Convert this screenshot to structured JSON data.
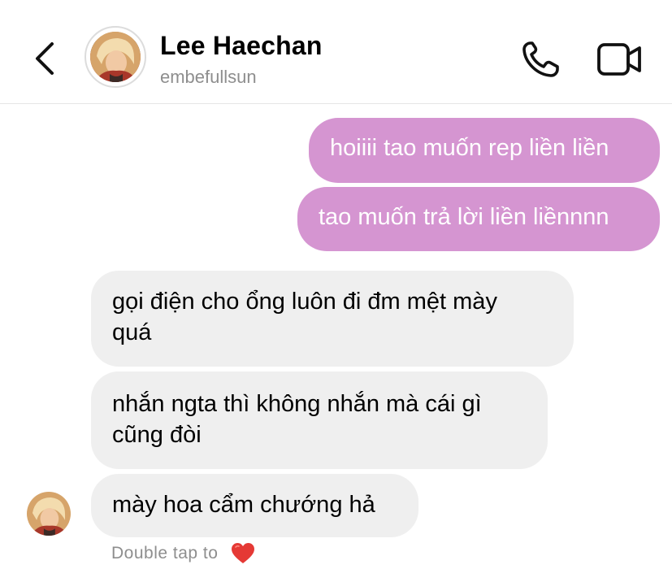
{
  "header": {
    "name": "Lee Haechan",
    "username": "embefullsun"
  },
  "messages": [
    {
      "direction": "sent",
      "text": "hoiiii tao muốn rep liền liền"
    },
    {
      "direction": "sent",
      "text": "tao muốn trả lời liền liềnnnn"
    },
    {
      "direction": "received",
      "lines": [
        "gọi điện cho ổng luôn đi đm mệt mày",
        "quá"
      ]
    },
    {
      "direction": "received",
      "lines": [
        "nhắn ngta thì không nhắn mà cái gì",
        "cũng đòi"
      ]
    },
    {
      "direction": "received",
      "text": "mày hoa cẩm chướng hả"
    }
  ],
  "footer": {
    "double_tap_text": "Double tap to"
  },
  "colors": {
    "sent_bubble": "#d595d1",
    "received_bubble": "#efefef",
    "secondary_text": "#8e8e8e",
    "heart": "#e53935"
  },
  "icons": [
    "back-chevron-icon",
    "phone-icon",
    "video-camera-icon",
    "heart-icon"
  ]
}
